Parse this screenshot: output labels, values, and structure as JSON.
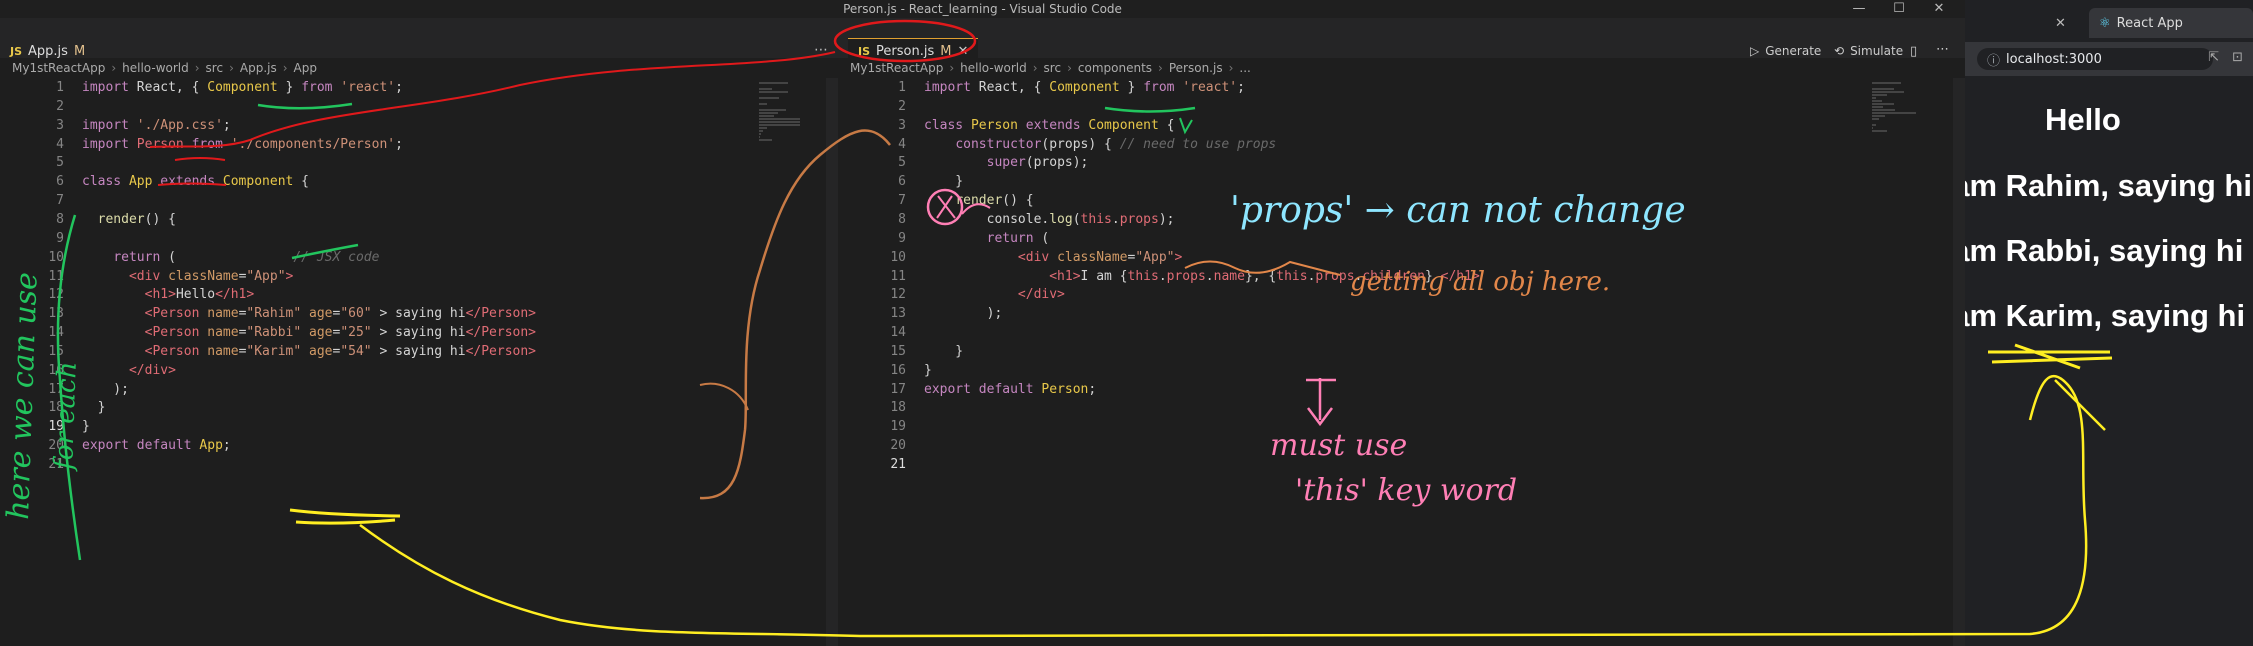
{
  "window": {
    "title": "Person.js - React_learning - Visual Studio Code",
    "controls": [
      "—",
      "☐",
      "✕"
    ]
  },
  "left_editor": {
    "tab": {
      "label": "App.js",
      "modified": "M"
    },
    "breadcrumb": [
      "My1stReactApp",
      "hello-world",
      "src",
      "App.js",
      "App"
    ],
    "lines": [
      [
        [
          "kw",
          "import"
        ],
        [
          "txt",
          " React, { "
        ],
        [
          "cls",
          "Component"
        ],
        [
          "txt",
          " } "
        ],
        [
          "kw",
          "from"
        ],
        [
          "txt",
          " "
        ],
        [
          "str",
          "'react'"
        ],
        [
          "txt",
          ";"
        ]
      ],
      [],
      [
        [
          "kw",
          "import"
        ],
        [
          "txt",
          " "
        ],
        [
          "str",
          "'./App.css'"
        ],
        [
          "txt",
          ";"
        ]
      ],
      [
        [
          "kw",
          "import"
        ],
        [
          "txt",
          " "
        ],
        [
          "var",
          "Person"
        ],
        [
          "txt",
          " "
        ],
        [
          "kw",
          "from"
        ],
        [
          "txt",
          " "
        ],
        [
          "str",
          "'./components/Person'"
        ],
        [
          "txt",
          ";"
        ]
      ],
      [],
      [
        [
          "kw",
          "class"
        ],
        [
          "txt",
          " "
        ],
        [
          "cls",
          "App"
        ],
        [
          "txt",
          " "
        ],
        [
          "kw",
          "extends"
        ],
        [
          "txt",
          " "
        ],
        [
          "cls",
          "Component"
        ],
        [
          "txt",
          " {"
        ]
      ],
      [],
      [
        [
          "txt",
          "  "
        ],
        [
          "fn",
          "render"
        ],
        [
          "txt",
          "() {"
        ]
      ],
      [],
      [
        [
          "txt",
          "    "
        ],
        [
          "kw",
          "return"
        ],
        [
          "txt",
          " (               "
        ],
        [
          "cmt",
          "// JSX code"
        ]
      ],
      [
        [
          "txt",
          "      "
        ],
        [
          "tag",
          "<div"
        ],
        [
          "txt",
          " "
        ],
        [
          "attr",
          "className"
        ],
        [
          "txt",
          "="
        ],
        [
          "str",
          "\"App\""
        ],
        [
          "tag",
          ">"
        ]
      ],
      [
        [
          "txt",
          "        "
        ],
        [
          "tag",
          "<h1>"
        ],
        [
          "txt",
          "Hello"
        ],
        [
          "tag",
          "</h1>"
        ]
      ],
      [
        [
          "txt",
          "        "
        ],
        [
          "tag",
          "<Person"
        ],
        [
          "txt",
          " "
        ],
        [
          "attr",
          "name"
        ],
        [
          "txt",
          "="
        ],
        [
          "str",
          "\"Rahim\""
        ],
        [
          "txt",
          " "
        ],
        [
          "attr",
          "age"
        ],
        [
          "txt",
          "="
        ],
        [
          "str",
          "\"60\""
        ],
        [
          "txt",
          " > saying hi"
        ],
        [
          "tag",
          "</Person>"
        ]
      ],
      [
        [
          "txt",
          "        "
        ],
        [
          "tag",
          "<Person"
        ],
        [
          "txt",
          " "
        ],
        [
          "attr",
          "name"
        ],
        [
          "txt",
          "="
        ],
        [
          "str",
          "\"Rabbi\""
        ],
        [
          "txt",
          " "
        ],
        [
          "attr",
          "age"
        ],
        [
          "txt",
          "="
        ],
        [
          "str",
          "\"25\""
        ],
        [
          "txt",
          " > saying hi"
        ],
        [
          "tag",
          "</Person>"
        ]
      ],
      [
        [
          "txt",
          "        "
        ],
        [
          "tag",
          "<Person"
        ],
        [
          "txt",
          " "
        ],
        [
          "attr",
          "name"
        ],
        [
          "txt",
          "="
        ],
        [
          "str",
          "\"Karim\""
        ],
        [
          "txt",
          " "
        ],
        [
          "attr",
          "age"
        ],
        [
          "txt",
          "="
        ],
        [
          "str",
          "\"54\""
        ],
        [
          "txt",
          " > saying hi"
        ],
        [
          "tag",
          "</Person>"
        ]
      ],
      [
        [
          "txt",
          "      "
        ],
        [
          "tag",
          "</div>"
        ]
      ],
      [
        [
          "txt",
          "    );"
        ]
      ],
      [
        [
          "txt",
          "  }"
        ]
      ],
      [
        [
          "txt",
          "}"
        ]
      ],
      [
        [
          "kw",
          "export"
        ],
        [
          "txt",
          " "
        ],
        [
          "kw",
          "default"
        ],
        [
          "txt",
          " "
        ],
        [
          "cls",
          "App"
        ],
        [
          "txt",
          ";"
        ]
      ],
      []
    ],
    "current_line": 19
  },
  "right_editor": {
    "tab": {
      "label": "Person.js",
      "modified": "M"
    },
    "breadcrumb": [
      "My1stReactApp",
      "hello-world",
      "src",
      "components",
      "Person.js",
      "..."
    ],
    "toolbar": [
      "Generate",
      "Simulate"
    ],
    "lines": [
      [
        [
          "kw",
          "import"
        ],
        [
          "txt",
          " React, { "
        ],
        [
          "cls",
          "Component"
        ],
        [
          "txt",
          " } "
        ],
        [
          "kw",
          "from"
        ],
        [
          "txt",
          " "
        ],
        [
          "str",
          "'react'"
        ],
        [
          "txt",
          ";"
        ]
      ],
      [],
      [
        [
          "kw",
          "class"
        ],
        [
          "txt",
          " "
        ],
        [
          "cls",
          "Person"
        ],
        [
          "txt",
          " "
        ],
        [
          "kw",
          "extends"
        ],
        [
          "txt",
          " "
        ],
        [
          "cls",
          "Component"
        ],
        [
          "txt",
          " {"
        ]
      ],
      [
        [
          "txt",
          "    "
        ],
        [
          "kw",
          "constructor"
        ],
        [
          "txt",
          "(props) { "
        ],
        [
          "cmt",
          "// need to use props"
        ]
      ],
      [
        [
          "txt",
          "        "
        ],
        [
          "kw",
          "super"
        ],
        [
          "txt",
          "(props);"
        ]
      ],
      [
        [
          "txt",
          "    }"
        ]
      ],
      [
        [
          "txt",
          "    "
        ],
        [
          "fn",
          "render"
        ],
        [
          "txt",
          "() {"
        ]
      ],
      [
        [
          "txt",
          "        console."
        ],
        [
          "fn",
          "log"
        ],
        [
          "txt",
          "("
        ],
        [
          "var",
          "this"
        ],
        [
          "txt",
          "."
        ],
        [
          "var",
          "props"
        ],
        [
          "txt",
          ");"
        ]
      ],
      [
        [
          "txt",
          "        "
        ],
        [
          "kw",
          "return"
        ],
        [
          "txt",
          " ("
        ]
      ],
      [
        [
          "txt",
          "            "
        ],
        [
          "tag",
          "<div"
        ],
        [
          "txt",
          " "
        ],
        [
          "attr",
          "className"
        ],
        [
          "txt",
          "="
        ],
        [
          "str",
          "\"App\""
        ],
        [
          "tag",
          ">"
        ]
      ],
      [
        [
          "txt",
          "                "
        ],
        [
          "tag",
          "<h1>"
        ],
        [
          "txt",
          "I am {"
        ],
        [
          "var",
          "this"
        ],
        [
          "txt",
          "."
        ],
        [
          "var",
          "props"
        ],
        [
          "txt",
          "."
        ],
        [
          "var",
          "name"
        ],
        [
          "txt",
          "}, {"
        ],
        [
          "var",
          "this"
        ],
        [
          "txt",
          "."
        ],
        [
          "var",
          "props"
        ],
        [
          "txt",
          "."
        ],
        [
          "var",
          "children"
        ],
        [
          "txt",
          "} "
        ],
        [
          "tag",
          "</h1>"
        ]
      ],
      [
        [
          "txt",
          "            "
        ],
        [
          "tag",
          "</div>"
        ]
      ],
      [
        [
          "txt",
          "        );"
        ]
      ],
      [],
      [
        [
          "txt",
          "    }"
        ]
      ],
      [
        [
          "txt",
          "}"
        ]
      ],
      [
        [
          "kw",
          "export"
        ],
        [
          "txt",
          " "
        ],
        [
          "kw",
          "default"
        ],
        [
          "txt",
          " "
        ],
        [
          "cls",
          "Person"
        ],
        [
          "txt",
          ";"
        ]
      ],
      [],
      [],
      [],
      []
    ],
    "current_line": 21
  },
  "browser": {
    "tab_title": "React App",
    "url": "localhost:3000",
    "heading": "Hello",
    "items": [
      "I am Rahim, saying hi",
      "I am Rabbi, saying hi",
      "I am Karim, saying hi"
    ]
  },
  "annotations": {
    "props_note": "'props' → can not change",
    "log_note": "getting all obj here.",
    "this_note_1": "must use",
    "this_note_2": "'this' key word",
    "side_note": "here we can use",
    "side_note_2": "for each"
  },
  "colors": {
    "accent_tab": "#e0a030",
    "ink_red": "#e0191b",
    "ink_green": "#22c55e",
    "ink_orange": "#e2874a",
    "ink_pink": "#ff7fb5",
    "ink_yellow": "#ffee22",
    "ink_cyan": "#8ee6ff",
    "ink_brown": "#c77a45"
  }
}
